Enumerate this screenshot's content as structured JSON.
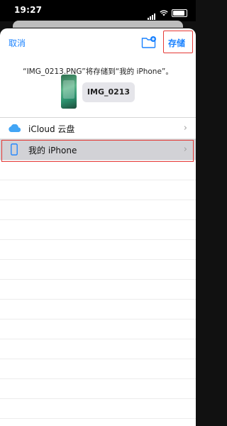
{
  "status_bar": {
    "time": "19:27"
  },
  "nav": {
    "cancel_label": "取消",
    "save_label": "存储",
    "new_folder_icon": "folder-plus-icon"
  },
  "description": "“IMG_0213.PNG”将存储到“我的 iPhone”。",
  "file": {
    "name": "IMG_0213"
  },
  "locations": [
    {
      "label": "iCloud 云盘",
      "icon": "cloud-icon",
      "selected": false
    },
    {
      "label": "我的 iPhone",
      "icon": "iphone-icon",
      "selected": true
    }
  ],
  "colors": {
    "accent": "#1a82ff",
    "highlight_border": "#e53935",
    "selected_row": "#d2d2d6"
  }
}
